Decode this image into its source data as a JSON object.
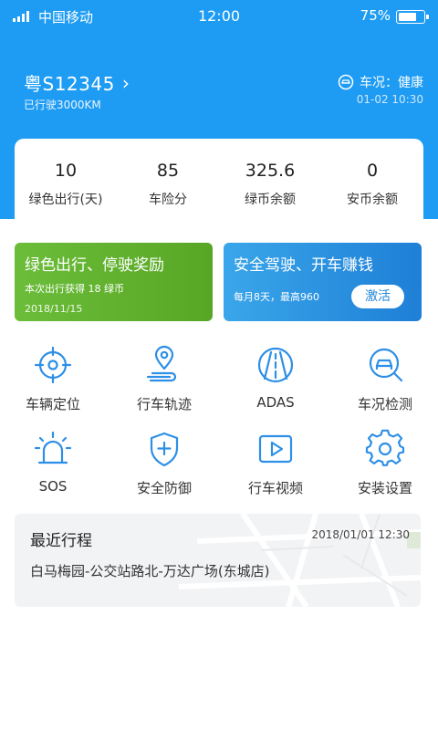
{
  "status_bar": {
    "carrier": "中国移动",
    "time": "12:00",
    "battery": "75%",
    "battery_level": 0.75
  },
  "vehicle": {
    "plate": "粤S12345",
    "mileage": "已行驶3000KM",
    "condition": "车况：健康",
    "condition_time": "01-02 10:30"
  },
  "stats": [
    {
      "value": "10",
      "label": "绿色出行(天)"
    },
    {
      "value": "85",
      "label": "车险分"
    },
    {
      "value": "325.6",
      "label": "绿币余额"
    },
    {
      "value": "0",
      "label": "安币余额"
    }
  ],
  "banners": {
    "green": {
      "title": "绿色出行、停驶奖励",
      "subtitle": "本次出行获得 18 绿币",
      "date": "2018/11/15"
    },
    "blue": {
      "title": "安全驾驶、开车赚钱",
      "subtitle": "每月8天，最高960",
      "button": "激活"
    }
  },
  "grid": [
    {
      "label": "车辆定位",
      "icon": "crosshair-icon"
    },
    {
      "label": "行车轨迹",
      "icon": "location-track-icon"
    },
    {
      "label": "ADAS",
      "icon": "road-icon"
    },
    {
      "label": "车况检测",
      "icon": "car-search-icon"
    },
    {
      "label": "SOS",
      "icon": "siren-icon"
    },
    {
      "label": "安全防御",
      "icon": "shield-plus-icon"
    },
    {
      "label": "行车视频",
      "icon": "video-play-icon"
    },
    {
      "label": "安装设置",
      "icon": "gear-icon"
    }
  ],
  "trip": {
    "title": "最近行程",
    "time": "2018/01/01 12:30",
    "route": "白马梅园-公交站路北-万达广场(东城店)"
  },
  "colors": {
    "brand_blue": "#1e9cf3",
    "icon_blue": "#2d8fe6",
    "green_banner": "#62b22f",
    "blue_banner": "#2a90e0"
  }
}
